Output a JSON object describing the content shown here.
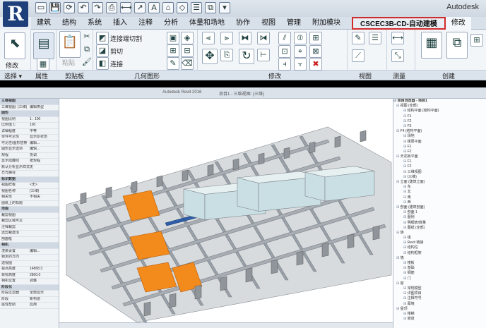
{
  "app": {
    "brand": "Autodesk",
    "logo_letter": "R"
  },
  "qat": {
    "icons": [
      "open-icon",
      "save-icon",
      "sync-icon",
      "undo-icon",
      "redo-icon",
      "print-icon",
      "measure-icon",
      "dimension-icon",
      "text-icon",
      "default-3d-icon",
      "section-icon",
      "thin-lines-icon",
      "window-icon",
      "dropdown-icon"
    ],
    "glyphs": [
      "▭",
      "💾",
      "⟳",
      "↶",
      "↷",
      "⎙",
      "⟷",
      "↗",
      "A",
      "⌂",
      "◇",
      "☰",
      "⧉",
      "▾"
    ]
  },
  "tabs": [
    {
      "label": "建筑"
    },
    {
      "label": "结构"
    },
    {
      "label": "系统"
    },
    {
      "label": "插入"
    },
    {
      "label": "注释"
    },
    {
      "label": "分析"
    },
    {
      "label": "体量和场地"
    },
    {
      "label": "协作"
    },
    {
      "label": "视图"
    },
    {
      "label": "管理"
    },
    {
      "label": "附加模块"
    },
    {
      "label": "CSCEC3B-CD-自动建模",
      "special": true
    },
    {
      "label": "修改",
      "active": true
    }
  ],
  "ribbon": {
    "modify_label": "修改",
    "paste_label": "粘贴",
    "join_cut": "连接端切割",
    "cut": "剪切",
    "connect": "连接"
  },
  "panel_titles": {
    "select": "选择 ▾",
    "properties": "属性",
    "clipboard": "剪贴板",
    "geometry": "几何图形",
    "modify": "修改",
    "view": "视图",
    "measure": "测量",
    "create": "创建"
  },
  "window_titles": [
    "Autodesk Revit 2016",
    "项目1 - 三维视图: {三维}"
  ],
  "properties": [
    {
      "k": "三维视图",
      "v": "",
      "hd": true
    },
    {
      "k": "三维视图: {三维}",
      "v": "编辑类型"
    },
    {
      "k": "图形",
      "v": "",
      "hd": true
    },
    {
      "k": "视图比例",
      "v": "1 : 100"
    },
    {
      "k": "比例值 1:",
      "v": "100"
    },
    {
      "k": "详细程度",
      "v": "中等"
    },
    {
      "k": "零件可见性",
      "v": "显示原状态"
    },
    {
      "k": "可见性/图形替换",
      "v": "编辑..."
    },
    {
      "k": "图形显示选项",
      "v": "编辑..."
    },
    {
      "k": "规程",
      "v": "协调"
    },
    {
      "k": "显示隐藏线",
      "v": "按规程"
    },
    {
      "k": "默认分析显示样式",
      "v": "无"
    },
    {
      "k": "日光路径",
      "v": ""
    },
    {
      "k": "标识数据",
      "v": "",
      "hd": true
    },
    {
      "k": "视图样板",
      "v": "<无>"
    },
    {
      "k": "视图名称",
      "v": "{三维}"
    },
    {
      "k": "相关性",
      "v": "不相关"
    },
    {
      "k": "图纸上的标题",
      "v": ""
    },
    {
      "k": "范围",
      "v": "",
      "hd": true
    },
    {
      "k": "裁剪视图",
      "v": ""
    },
    {
      "k": "裁剪区域可见",
      "v": ""
    },
    {
      "k": "注释裁剪",
      "v": ""
    },
    {
      "k": "远剪裁激活",
      "v": ""
    },
    {
      "k": "剖面框",
      "v": ""
    },
    {
      "k": "相机",
      "v": "",
      "hd": true
    },
    {
      "k": "渲染设置",
      "v": "编辑..."
    },
    {
      "k": "锁定的方向",
      "v": ""
    },
    {
      "k": "透视图",
      "v": ""
    },
    {
      "k": "视点高度",
      "v": "14868.3"
    },
    {
      "k": "目标高度",
      "v": "2800.0"
    },
    {
      "k": "相机位置",
      "v": "调整"
    },
    {
      "k": "阶段化",
      "v": "",
      "hd": true
    },
    {
      "k": "阶段过滤器",
      "v": "全部显示"
    },
    {
      "k": "阶段",
      "v": "新构造"
    },
    {
      "k": "属性帮助",
      "v": "应用"
    }
  ],
  "browser": {
    "title": "项目浏览器 - 项目1",
    "items": [
      "视图 (全部)",
      "结构平面 (结构平面)",
      "F1",
      "F2",
      "F3",
      "F4 (结构平面)",
      "场地",
      "楼层平面",
      "F1",
      "F2",
      "天花板平面",
      "F1",
      "F2",
      "三维视图",
      "{三维}",
      "立面 (建筑立面)",
      "东",
      "北",
      "南",
      "西",
      "剖面 (建筑剖面)",
      "剖面 1",
      "图例",
      "明细表/数量",
      "图纸 (全部)",
      "族",
      "组",
      "Revit 链接",
      "结构柱",
      "结构框架",
      "墙",
      "楼板",
      "基础",
      "钢筋",
      "门",
      "窗",
      "常规模型",
      "详图项目",
      "注释符号",
      "幕墙",
      "屋顶",
      "楼梯",
      "坡道"
    ]
  },
  "colors": {
    "accent_red": "#d12a2a",
    "orange": "#f28a1c",
    "wall": "#c9dfe3",
    "slab": "#d8dbde",
    "blue": "#2f5ea8"
  }
}
